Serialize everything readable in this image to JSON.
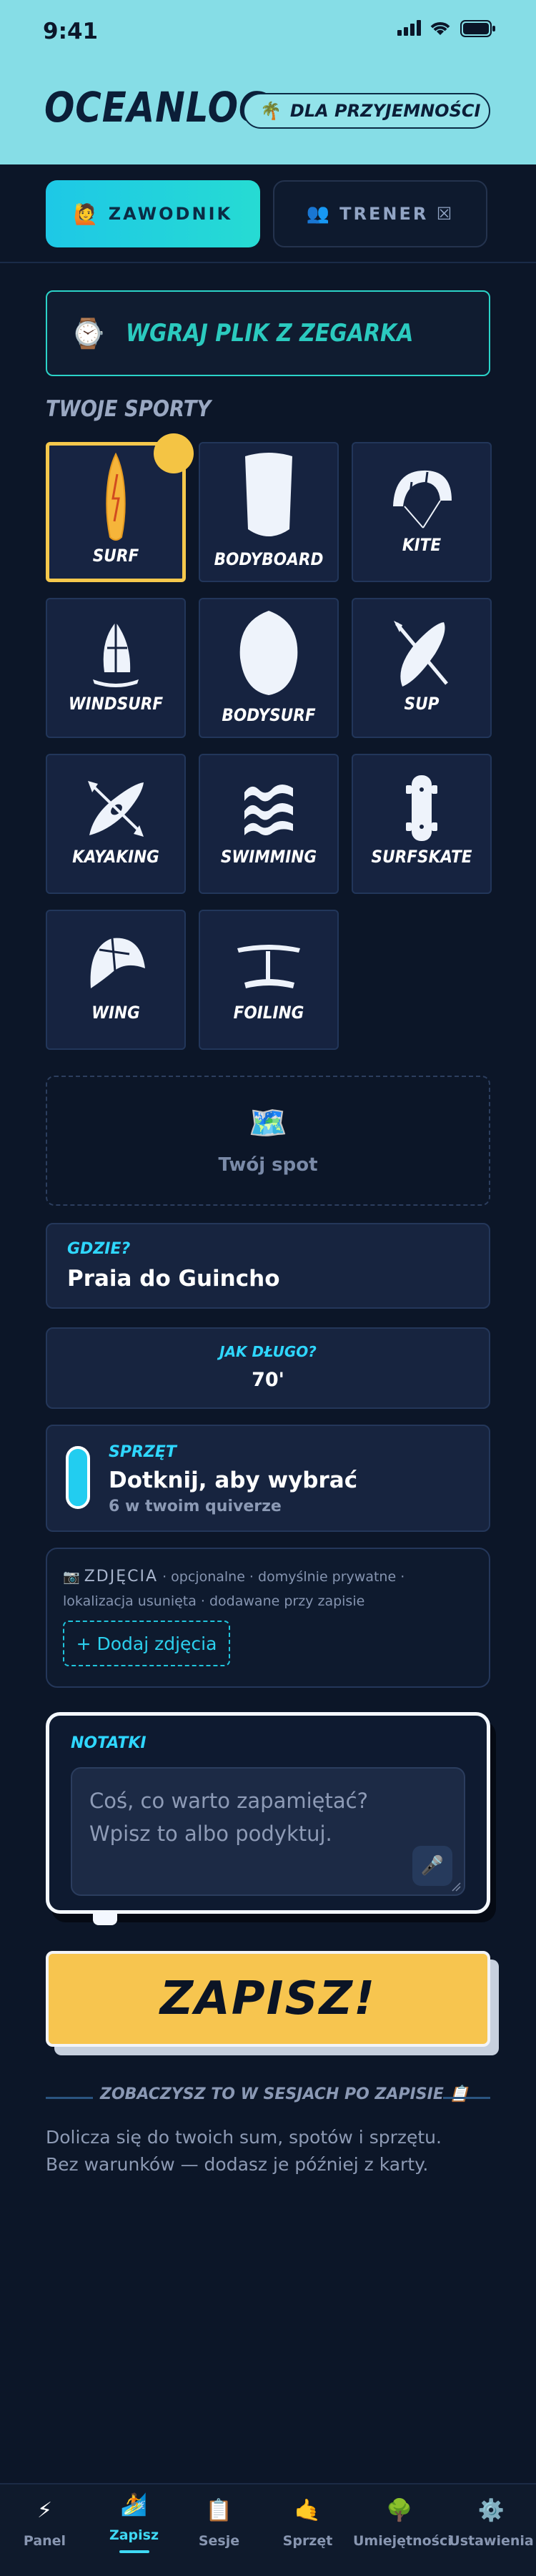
{
  "status_bar": {
    "time": "9:41"
  },
  "header": {
    "title": "OCEANLOG",
    "chip_icon": "palm-tree-icon",
    "chip_label": "DLA PRZYJEMNOŚCI"
  },
  "role_toggle": {
    "athlete": {
      "label": "ZAWODNIK",
      "icon": "person-raising-hand-icon",
      "active": true
    },
    "coach": {
      "label": "TRENER ☒",
      "icon": "people-icon",
      "active": false
    }
  },
  "upload": {
    "label": "WGRAJ PLIK Z ZEGARKA",
    "icon": "watch-icon"
  },
  "sports": {
    "title": "TWOJE SPORTY",
    "items": [
      {
        "label": "SURF",
        "selected": true
      },
      {
        "label": "BODYBOARD"
      },
      {
        "label": "KITE"
      },
      {
        "label": "WINDSURF"
      },
      {
        "label": "BODYSURF"
      },
      {
        "label": "SUP"
      },
      {
        "label": "KAYAKING"
      },
      {
        "label": "SWIMMING"
      },
      {
        "label": "SURFSKATE"
      },
      {
        "label": "WING"
      },
      {
        "label": "FOILING"
      }
    ]
  },
  "spot": {
    "label": "Twój spot",
    "icon": "map-icon"
  },
  "where": {
    "label": "GDZIE?",
    "value": "Praia do Guincho"
  },
  "duration": {
    "label": "JAK DŁUGO?",
    "value": "70'"
  },
  "gear": {
    "label": "SPRZĘT",
    "value": "Dotknij, aby wybrać",
    "sub": "6 w twoim quiverze"
  },
  "photos": {
    "icon": "camera-icon",
    "title": "ZDJĘCIA",
    "desc": "· opcjonalne · domyślnie prywatne · lokalizacja usunięta · dodawane przy zapisie",
    "button": "+ Dodaj zdjęcia"
  },
  "notes": {
    "label": "NOTATKI",
    "placeholder_line1": "Coś, co warto zapamiętać?",
    "placeholder_line2": "Wpisz to albo podyktuj."
  },
  "save_button": "ZAPISZ!",
  "info": {
    "heading": "ZOBACZYSZ TO W SESJACH PO ZAPISIE 📋",
    "text": "Dolicza się do twoich sum, spotów i sprzętu. Bez warunków — dodasz je później z karty."
  },
  "tabs": [
    {
      "label": "Panel",
      "icon": "lightning-icon",
      "active": false
    },
    {
      "label": "Zapisz",
      "icon": "surfer-icon",
      "active": true
    },
    {
      "label": "Sesje",
      "icon": "clipboard-icon",
      "active": false
    },
    {
      "label": "Sprzęt",
      "icon": "shaka-icon",
      "active": false
    },
    {
      "label": "Umiejętności",
      "icon": "tree-icon",
      "active": false
    },
    {
      "label": "Ustawienia",
      "icon": "gear-icon",
      "active": false
    }
  ],
  "colors": {
    "accent": "#2fd7ff",
    "save": "#f7c54f",
    "background": "#0c1628",
    "header": "#86dde6"
  }
}
